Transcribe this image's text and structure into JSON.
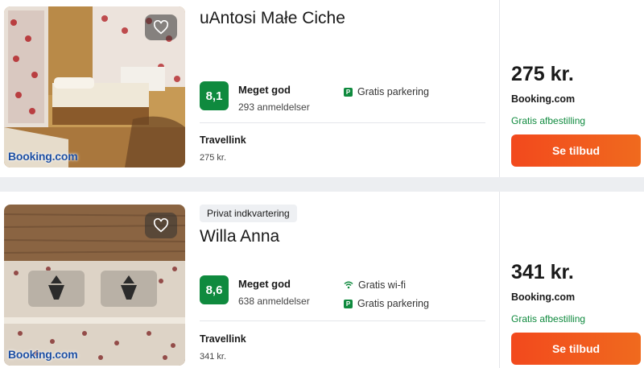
{
  "listings": [
    {
      "tag": "",
      "title": "uAntosi Małe Ciche",
      "rating_score": "8,1",
      "rating_word": "Meget god",
      "reviews": "293 anmeldelser",
      "amenities": [
        {
          "icon": "parking-icon",
          "label": "Gratis parkering"
        }
      ],
      "provider": "Travellink",
      "provider_price": "275 kr.",
      "price": "275 kr.",
      "site": "Booking.com",
      "cancellation": "Gratis afbestilling",
      "cta_label": "Se tilbud",
      "photo_logo": "Booking.com"
    },
    {
      "tag": "Privat indkvartering",
      "title": "Willa Anna",
      "rating_score": "8,6",
      "rating_word": "Meget god",
      "reviews": "638 anmeldelser",
      "amenities": [
        {
          "icon": "wifi-icon",
          "label": "Gratis wi-fi"
        },
        {
          "icon": "parking-icon",
          "label": "Gratis parkering"
        }
      ],
      "provider": "Travellink",
      "provider_price": "341 kr.",
      "price": "341 kr.",
      "site": "Booking.com",
      "cancellation": "Gratis afbestilling",
      "cta_label": "Se tilbud",
      "photo_logo": "Booking.com"
    }
  ],
  "colors": {
    "rating_green": "#0f8a3e",
    "cta_orange": "#f2491d",
    "logo_blue": "#1d4fa3"
  }
}
